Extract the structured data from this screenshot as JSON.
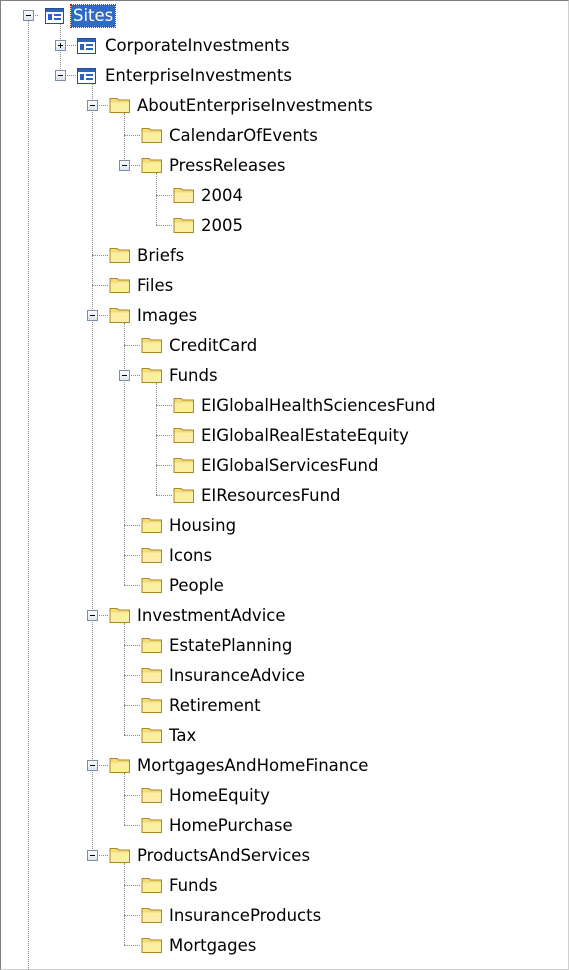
{
  "tree": {
    "nodes": [
      {
        "label": "Sites",
        "depth": 0,
        "type": "site",
        "expander": "minus",
        "selected": true
      },
      {
        "label": "CorporateInvestments",
        "depth": 1,
        "type": "site",
        "expander": "plus"
      },
      {
        "label": "EnterpriseInvestments",
        "depth": 1,
        "type": "site",
        "expander": "minus"
      },
      {
        "label": "AboutEnterpriseInvestments",
        "depth": 2,
        "type": "folder",
        "expander": "minus"
      },
      {
        "label": "CalendarOfEvents",
        "depth": 3,
        "type": "folder",
        "expander": "none"
      },
      {
        "label": "PressReleases",
        "depth": 3,
        "type": "folder",
        "expander": "minus"
      },
      {
        "label": "2004",
        "depth": 4,
        "type": "folder",
        "expander": "none"
      },
      {
        "label": "2005",
        "depth": 4,
        "type": "folder",
        "expander": "none"
      },
      {
        "label": "Briefs",
        "depth": 2,
        "type": "folder",
        "expander": "none"
      },
      {
        "label": "Files",
        "depth": 2,
        "type": "folder",
        "expander": "none"
      },
      {
        "label": "Images",
        "depth": 2,
        "type": "folder",
        "expander": "minus"
      },
      {
        "label": "CreditCard",
        "depth": 3,
        "type": "folder",
        "expander": "none"
      },
      {
        "label": "Funds",
        "depth": 3,
        "type": "folder",
        "expander": "minus"
      },
      {
        "label": "EIGlobalHealthSciencesFund",
        "depth": 4,
        "type": "folder",
        "expander": "none"
      },
      {
        "label": "EIGlobalRealEstateEquity",
        "depth": 4,
        "type": "folder",
        "expander": "none"
      },
      {
        "label": "EIGlobalServicesFund",
        "depth": 4,
        "type": "folder",
        "expander": "none"
      },
      {
        "label": "EIResourcesFund",
        "depth": 4,
        "type": "folder",
        "expander": "none"
      },
      {
        "label": "Housing",
        "depth": 3,
        "type": "folder",
        "expander": "none"
      },
      {
        "label": "Icons",
        "depth": 3,
        "type": "folder",
        "expander": "none"
      },
      {
        "label": "People",
        "depth": 3,
        "type": "folder",
        "expander": "none"
      },
      {
        "label": "InvestmentAdvice",
        "depth": 2,
        "type": "folder",
        "expander": "minus"
      },
      {
        "label": "EstatePlanning",
        "depth": 3,
        "type": "folder",
        "expander": "none"
      },
      {
        "label": "InsuranceAdvice",
        "depth": 3,
        "type": "folder",
        "expander": "none"
      },
      {
        "label": "Retirement",
        "depth": 3,
        "type": "folder",
        "expander": "none"
      },
      {
        "label": "Tax",
        "depth": 3,
        "type": "folder",
        "expander": "none"
      },
      {
        "label": "MortgagesAndHomeFinance",
        "depth": 2,
        "type": "folder",
        "expander": "minus"
      },
      {
        "label": "HomeEquity",
        "depth": 3,
        "type": "folder",
        "expander": "none"
      },
      {
        "label": "HomePurchase",
        "depth": 3,
        "type": "folder",
        "expander": "none"
      },
      {
        "label": "ProductsAndServices",
        "depth": 2,
        "type": "folder",
        "expander": "minus"
      },
      {
        "label": "Funds",
        "depth": 3,
        "type": "folder",
        "expander": "none"
      },
      {
        "label": "InsuranceProducts",
        "depth": 3,
        "type": "folder",
        "expander": "none"
      },
      {
        "label": "Mortgages",
        "depth": 3,
        "type": "folder",
        "expander": "none"
      }
    ]
  },
  "colors": {
    "folder_fill": "#f2dc73",
    "folder_edge": "#a8862a",
    "site_icon": "#2a63c2",
    "selection": "#316ac5",
    "tree_lines": "#8c8c8c"
  }
}
